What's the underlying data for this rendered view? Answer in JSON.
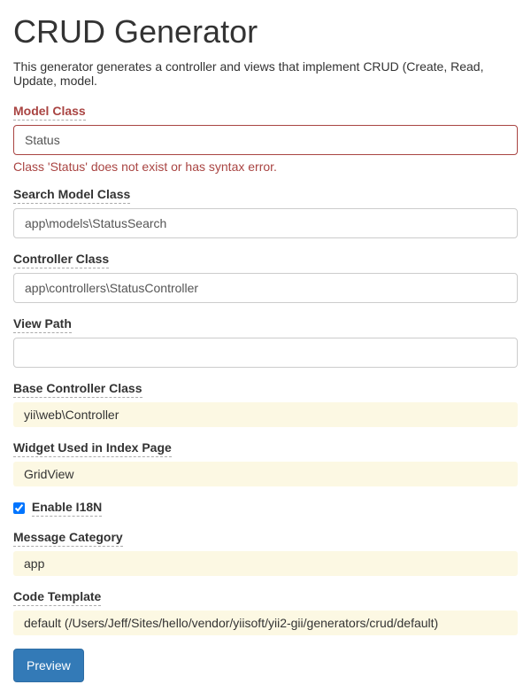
{
  "header": {
    "title": "CRUD Generator",
    "description": "This generator generates a controller and views that implement CRUD (Create, Read, Update, model."
  },
  "fields": {
    "modelClass": {
      "label": "Model Class",
      "value": "Status",
      "error": "Class 'Status' does not exist or has syntax error."
    },
    "searchModelClass": {
      "label": "Search Model Class",
      "value": "app\\models\\StatusSearch"
    },
    "controllerClass": {
      "label": "Controller Class",
      "value": "app\\controllers\\StatusController"
    },
    "viewPath": {
      "label": "View Path",
      "value": ""
    },
    "baseControllerClass": {
      "label": "Base Controller Class",
      "value": "yii\\web\\Controller"
    },
    "indexWidget": {
      "label": "Widget Used in Index Page",
      "value": "GridView"
    },
    "enableI18N": {
      "label": "Enable I18N",
      "checked": true
    },
    "messageCategory": {
      "label": "Message Category",
      "value": "app"
    },
    "codeTemplate": {
      "label": "Code Template",
      "value": "default (/Users/Jeff/Sites/hello/vendor/yiisoft/yii2-gii/generators/crud/default)"
    }
  },
  "actions": {
    "preview": "Preview"
  }
}
